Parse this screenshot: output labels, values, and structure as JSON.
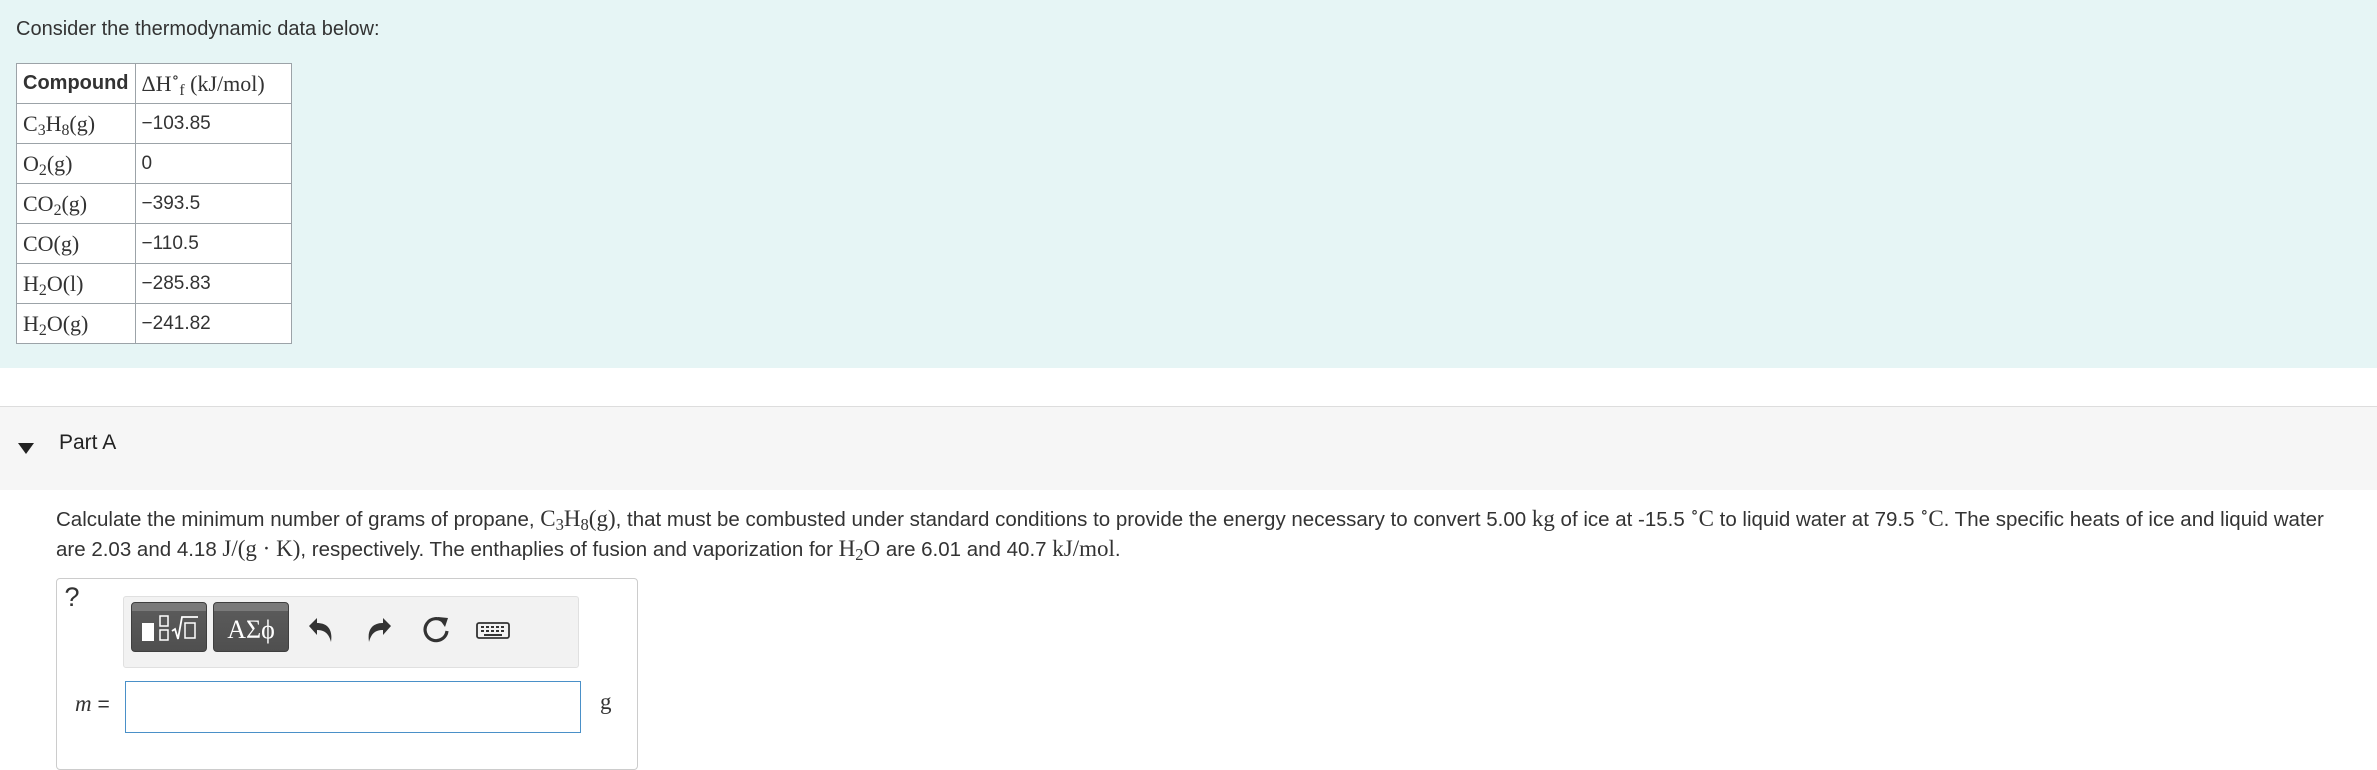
{
  "intro": {
    "text": "Consider the thermodynamic data below:",
    "table": {
      "header_compound": "Compound",
      "header_enthalpy_unit": "(kJ/mol)",
      "rows": [
        {
          "value": "−103.85"
        },
        {
          "value": "0"
        },
        {
          "value": "−393.5"
        },
        {
          "value": "−110.5"
        },
        {
          "value": "−285.83"
        },
        {
          "value": "−241.82"
        }
      ]
    }
  },
  "part": {
    "title": "Part A",
    "question": {
      "p1": "Calculate the minimum number of grams of propane, ",
      "p2": ", that must be combusted under standard conditions to provide the energy necessary to convert 5.00 ",
      "kg": "kg",
      "p3": " of ice at -15.5 ",
      "p4": " to liquid water at 79.5 ",
      "p5": ". The specific heats of ice and liquid water are 2.03 and 4.18 ",
      "heat_unit": "J/(g · K)",
      "p6": ", respectively. The enthaplies of fusion and vaporization for ",
      "p7": " are 6.01 and 40.7 ",
      "mol_unit": "kJ/mol",
      "p8": "."
    }
  },
  "answer": {
    "variable": "m",
    "equals": " =",
    "value": "",
    "unit": "g",
    "symbols_label": "ΑΣϕ",
    "help_label": "?"
  },
  "icons": [
    "caret-down-icon",
    "templates-icon",
    "undo-icon",
    "redo-icon",
    "reset-icon",
    "keyboard-icon",
    "help-icon"
  ],
  "colors": {
    "intro_background": "#e6f5f5",
    "input_border": "#4a90c8",
    "toolbar_button": "#555555"
  }
}
